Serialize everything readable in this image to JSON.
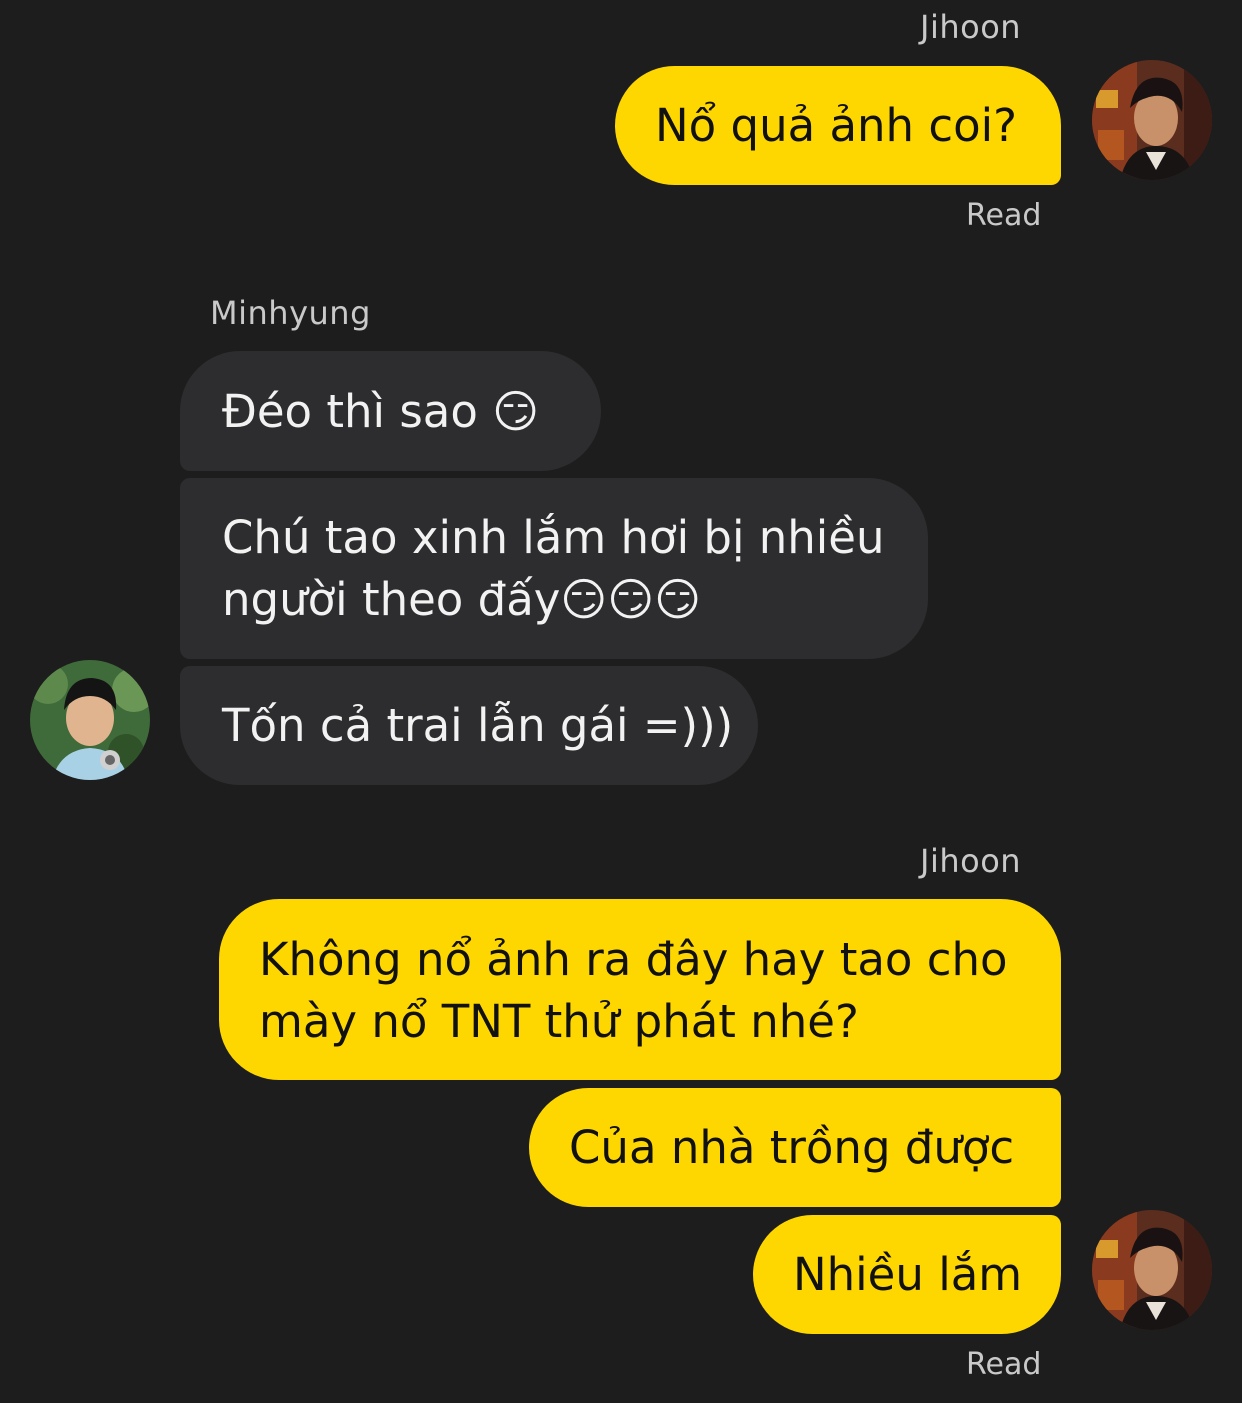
{
  "messages": [
    {
      "sender": "Jihoon",
      "text": "Nổ quả ảnh coi?",
      "status": "Read"
    },
    {
      "sender": "Minhyung",
      "text1": "Đéo thì sao 😏",
      "text2_line1": "Chú tao xinh lắm hơi bị nhiều",
      "text2_line2": "người theo đấy😏😏😏",
      "text3": "Tốn cả trai lẫn gái =)))"
    },
    {
      "sender": "Jihoon",
      "text1_line1": "Không nổ ảnh ra đây hay tao cho",
      "text1_line2": "mày nổ TNT thử phát nhé?",
      "text2": "Của nhà trồng được",
      "text3": "Nhiều lắm",
      "status": "Read"
    }
  ],
  "colors": {
    "background": "#1d1d1d",
    "outgoing_bubble": "#fed700",
    "incoming_bubble": "#2d2d2f"
  }
}
